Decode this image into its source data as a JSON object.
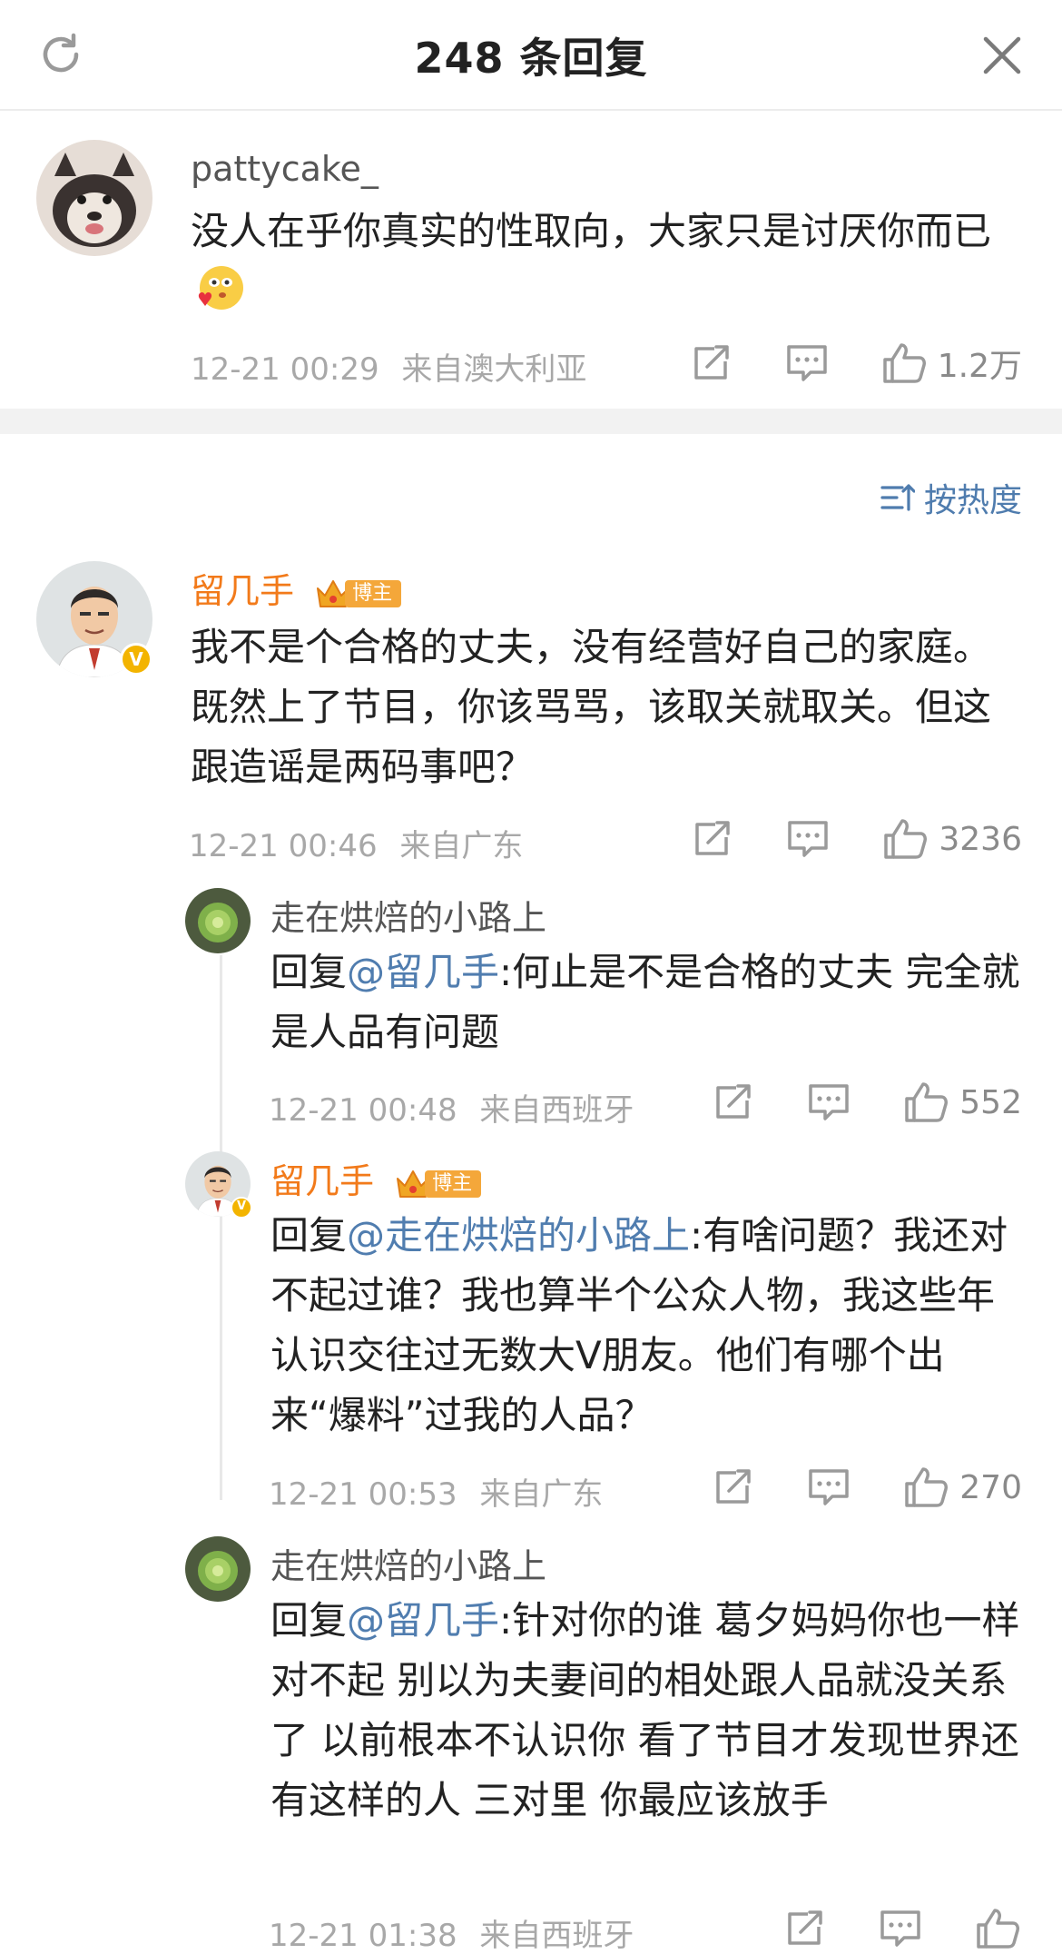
{
  "header": {
    "title": "248 条回复"
  },
  "main_comment": {
    "username": "pattycake_",
    "text": "没人在乎你真实的性取向，大家只是讨厌你而已",
    "timestamp": "12-21 00:29",
    "location": "来自澳大利亚",
    "likes": "1.2万"
  },
  "sort": {
    "label": "按热度"
  },
  "replies": [
    {
      "username": "留几手",
      "badge": "博主",
      "text": "我不是个合格的丈夫，没有经营好自己的家庭。既然上了节目，你该骂骂，该取关就取关。但这跟造谣是两码事吧？",
      "timestamp": "12-21 00:46",
      "location": "来自广东",
      "likes": "3236"
    },
    {
      "username": "走在烘焙的小路上",
      "reply_prefix": "回复",
      "mention": "@留几手",
      "text": ":何止是不是合格的丈夫 完全就是人品有问题",
      "timestamp": "12-21 00:48",
      "location": "来自西班牙",
      "likes": "552"
    },
    {
      "username": "留几手",
      "badge": "博主",
      "reply_prefix": "回复",
      "mention": "@走在烘焙的小路上",
      "text": ":有啥问题？我还对不起过谁？我也算半个公众人物，我这些年认识交往过无数大V朋友。他们有哪个出来“爆料”过我的人品？",
      "timestamp": "12-21 00:53",
      "location": "来自广东",
      "likes": "270"
    },
    {
      "username": "走在烘焙的小路上",
      "reply_prefix": "回复",
      "mention": "@留几手",
      "text": ":针对你的谁 葛夕妈妈你也一样对不起 别以为夫妻间的相处跟人品就没关系了 以前根本不认识你 看了节目才发现世界还有这样的人 三对里 你最应该放手",
      "timestamp": "12-21 01:38",
      "location": "来自西班牙"
    }
  ],
  "colors": {
    "accent_orange": "#f27a1a",
    "mention_blue": "#507daf",
    "meta_gray": "#a8a8a8"
  },
  "icons": [
    "refresh-icon",
    "close-icon",
    "share-icon",
    "comment-icon",
    "like-icon",
    "sort-icon",
    "crown-icon",
    "verified-icon",
    "emoji-icon"
  ]
}
